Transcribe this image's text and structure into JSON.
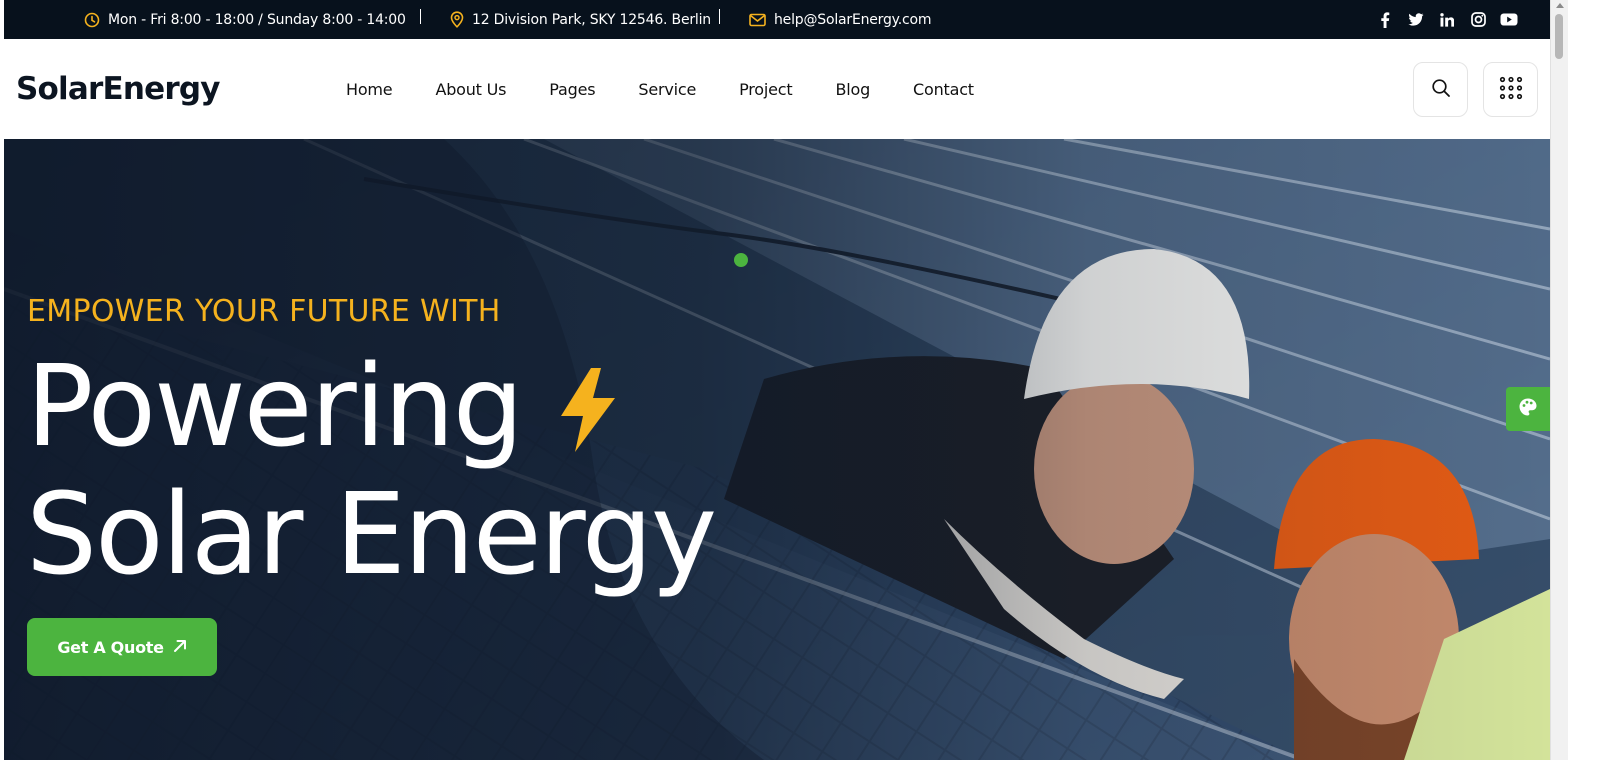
{
  "topbar": {
    "hours": "Mon - Fri 8:00 - 18:00 / Sunday 8:00 - 14:00",
    "address": "12 Division Park, SKY 12546. Berlin",
    "email": "help@SolarEnergy.com",
    "socials": [
      "facebook-icon",
      "twitter-icon",
      "linkedin-icon",
      "instagram-icon",
      "youtube-icon"
    ]
  },
  "header": {
    "logo": "SolarEnergy",
    "nav": [
      "Home",
      "About Us",
      "Pages",
      "Service",
      "Project",
      "Blog",
      "Contact"
    ]
  },
  "hero": {
    "subtitle": "EMPOWER YOUR FUTURE WITH",
    "headline_line1": "Powering",
    "headline_line2": "Solar Energy",
    "cta_label": "Get A Quote"
  },
  "colors": {
    "accent_green": "#4cb43f",
    "accent_yellow": "#f5b21e",
    "dark": "#07111c"
  }
}
